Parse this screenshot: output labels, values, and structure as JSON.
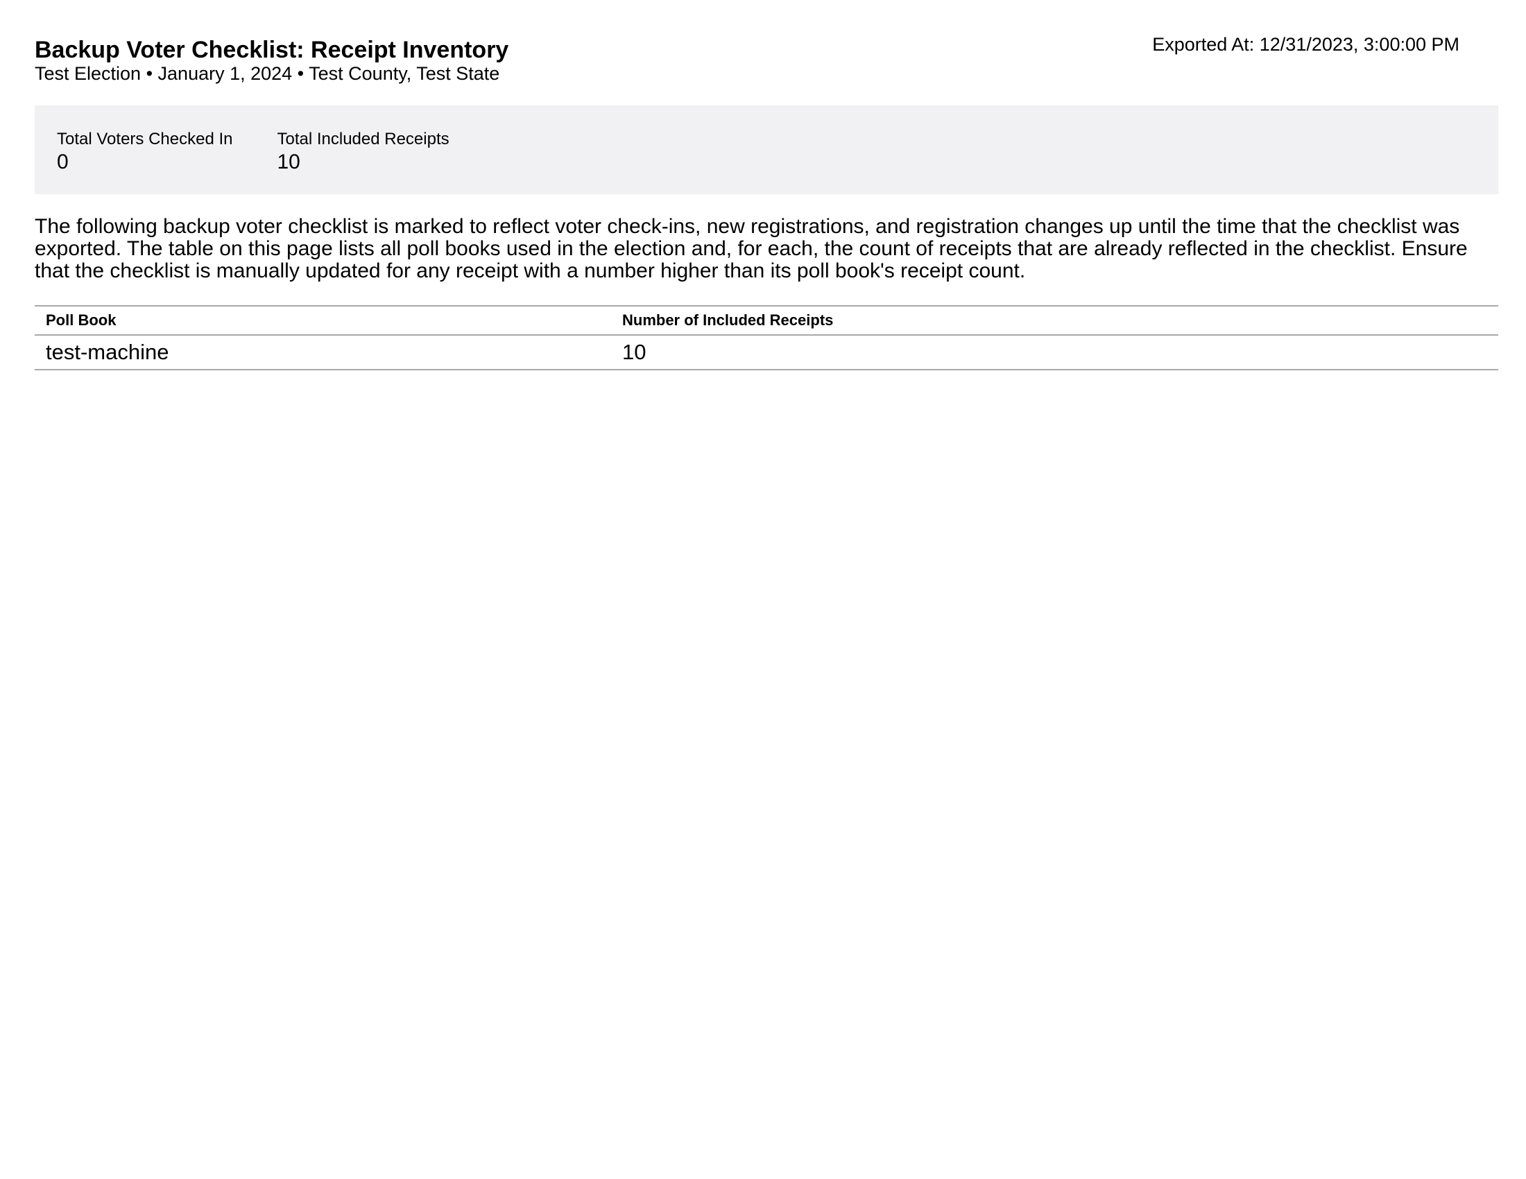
{
  "header": {
    "title": "Backup Voter Checklist: Receipt Inventory",
    "subtitle": "Test Election • January 1, 2024 • Test County, Test State",
    "exported_at": "Exported At: 12/31/2023, 3:00:00 PM"
  },
  "summary": {
    "stats": [
      {
        "label": "Total Voters Checked In",
        "value": "0"
      },
      {
        "label": "Total Included Receipts",
        "value": "10"
      }
    ]
  },
  "description": "The following backup voter checklist is marked to reflect voter check-ins, new registrations, and registration changes up until the time that the checklist was exported. The table on this page lists all poll books used in the election and, for each, the count of receipts that are already reflected in the checklist. Ensure that the checklist is manually updated for any receipt with a number higher than its poll book's receipt count.",
  "table": {
    "headers": [
      "Poll Book",
      "Number of Included Receipts"
    ],
    "rows": [
      [
        "test-machine",
        "10"
      ]
    ]
  },
  "colors": {
    "summary_background": "#f1f1f3",
    "table_rule": "#a8a8a8"
  }
}
